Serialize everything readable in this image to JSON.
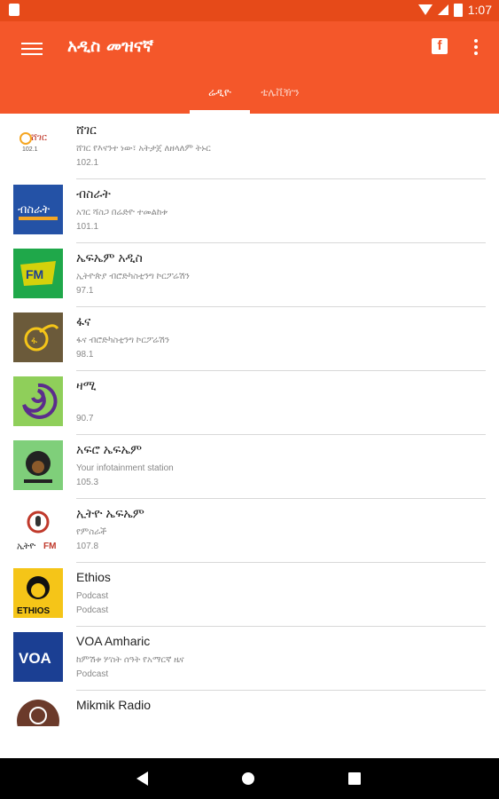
{
  "status_bar": {
    "time": "1:07"
  },
  "app_bar": {
    "title": "አዲስ መዝናኛ",
    "tabs": [
      {
        "label": "ሬዲዮ",
        "active": true
      },
      {
        "label": "ቴሌቪዥን",
        "active": false
      }
    ]
  },
  "stations": [
    {
      "name": "ሸገር",
      "description": "ሸገር የእናንተ ነው፣ አትታጀ ለዘላለም ትኑር",
      "frequency": "102.1",
      "logo": "sheger-logo"
    },
    {
      "name": "ብስራት",
      "description": "አገር ሻስጋ በሬድዮ ተመልከቱ",
      "frequency": "101.1",
      "logo": "bisrat-logo"
    },
    {
      "name": "ኤፍኤም አዲስ",
      "description": "ኢትዮጵያ ብሮድካስቲንግ ኮርፖሬሽን",
      "frequency": "97.1",
      "logo": "fm-addis-logo"
    },
    {
      "name": "ፋና",
      "description": "ፋና ብሮድካስቲንግ ኮርፖሬሽን",
      "frequency": "98.1",
      "logo": "fana-logo"
    },
    {
      "name": "ዛሚ",
      "description": "",
      "frequency": "90.7",
      "logo": "zami-logo"
    },
    {
      "name": "አፍሮ ኤፍኤም",
      "description": "Your infotainment station",
      "frequency": "105.3",
      "logo": "afro-fm-logo"
    },
    {
      "name": "ኢትዮ ኤፍኤም",
      "description": "የምስራች",
      "frequency": "107.8",
      "logo": "ethio-fm-logo"
    },
    {
      "name": "Ethios",
      "description": "Podcast",
      "frequency": "Podcast",
      "logo": "ethios-logo"
    },
    {
      "name": "VOA Amharic",
      "description": "ከምሽቱ ሦስት ሰዓት የአማርኛ ዜና",
      "frequency": "Podcast",
      "logo": "voa-logo"
    },
    {
      "name": "Mikmik Radio",
      "description": "",
      "frequency": "",
      "logo": "mikmik-logo"
    }
  ],
  "logos": {
    "sheger_text": "ሸገር",
    "fm_text": "FM",
    "ethio_text": "ኢትዮ",
    "ethios_text": "ETHIOS",
    "voa_text": "VOA"
  },
  "colors": {
    "status_bar": "#e64a19",
    "app_bar": "#f4572a",
    "bisrat_blue": "#2452a6",
    "fm_addis_green": "#1fa84a",
    "fana_brown": "#6b5a3a",
    "zami_green": "#8fcf5a",
    "ethios_yellow": "#f5c518",
    "voa_blue": "#1b3f93"
  }
}
